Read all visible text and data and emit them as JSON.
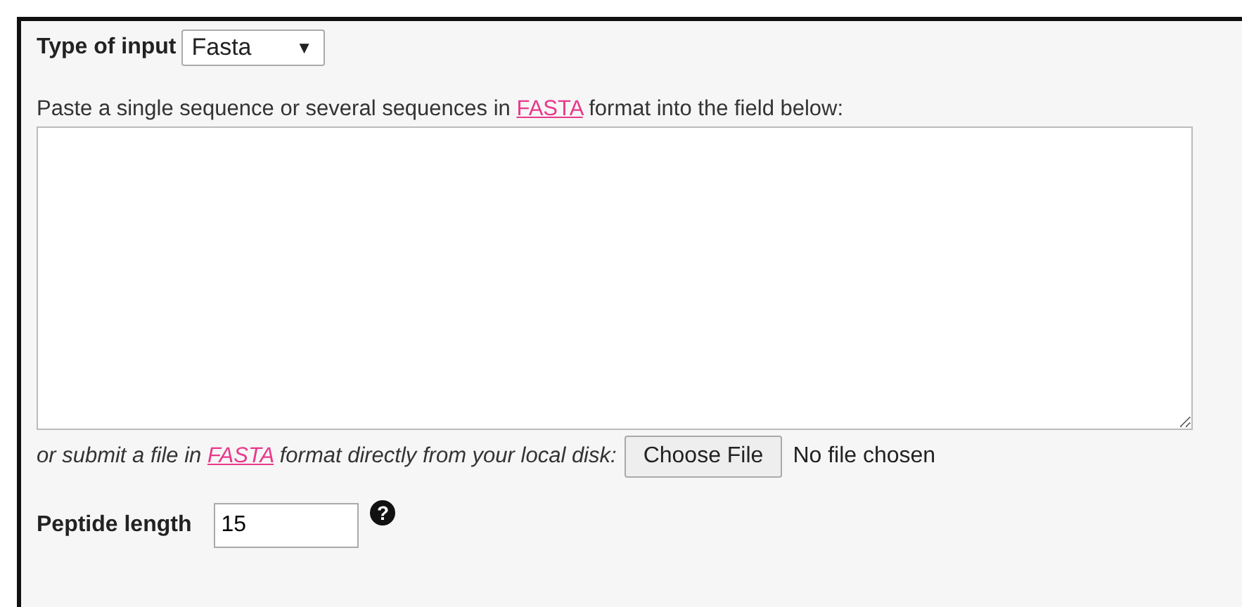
{
  "input_type": {
    "label": "Type of input",
    "value": "Fasta",
    "arrow": "▼"
  },
  "paste": {
    "before": "Paste a single sequence or several sequences in ",
    "link": "FASTA",
    "after": " format into the field below:"
  },
  "file": {
    "before": "or submit a file in ",
    "link": "FASTA",
    "after": " format directly from your local disk:",
    "button": "Choose File",
    "status": "No file chosen"
  },
  "peptide": {
    "label": "Peptide length",
    "value": "15",
    "help": "?"
  }
}
